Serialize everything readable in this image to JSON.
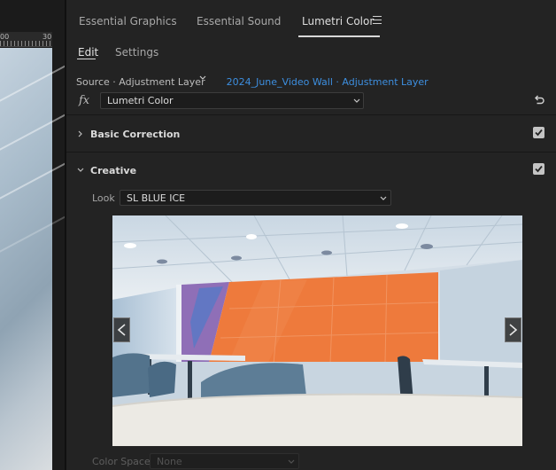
{
  "left_panel": {
    "ruler_labels": [
      "00",
      "30"
    ]
  },
  "tabs": [
    {
      "label": "Essential Graphics",
      "active": false
    },
    {
      "label": "Essential Sound",
      "active": false
    },
    {
      "label": "Lumetri Color",
      "active": true
    }
  ],
  "subtabs": [
    {
      "label": "Edit",
      "active": true
    },
    {
      "label": "Settings",
      "active": false
    }
  ],
  "source": {
    "source_text": "Source · Adjustment Layer",
    "clip_name": "2024_June_Video Wall",
    "separator": " · ",
    "clip_layer": "Adjustment Layer"
  },
  "effect": {
    "fx_label": "fx",
    "selected": "Lumetri Color"
  },
  "sections": [
    {
      "title": "Basic Correction",
      "expanded": false,
      "enabled": true
    },
    {
      "title": "Creative",
      "expanded": true,
      "enabled": true
    }
  ],
  "creative": {
    "look_label": "Look",
    "look_value": "SL BLUE ICE",
    "color_space_label": "Color Space",
    "color_space_value": "None"
  },
  "icons": {
    "menu": "hamburger-menu-icon",
    "reset": "reset-icon",
    "prev": "chevron-left-icon",
    "next": "chevron-right-icon"
  },
  "colors": {
    "accent_link": "#3d8fe0",
    "panel_bg": "#232323",
    "video_wall": "#ee7a3c"
  }
}
